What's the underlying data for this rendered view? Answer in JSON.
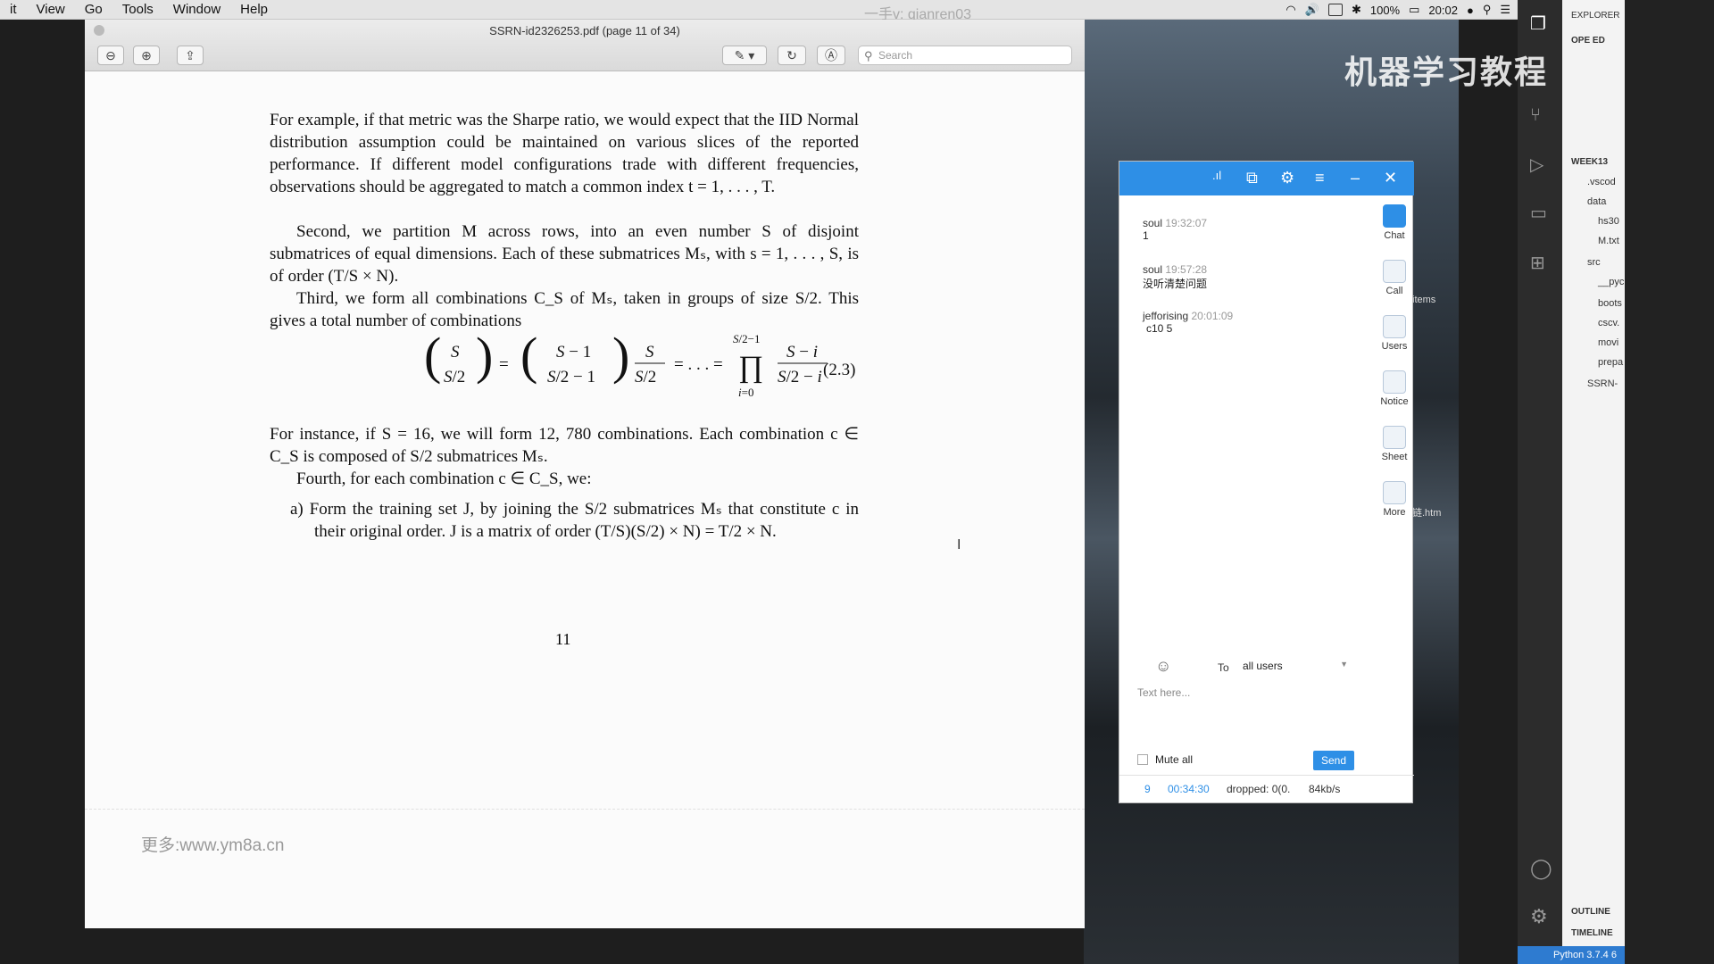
{
  "menubar": {
    "items": [
      "it",
      "View",
      "Go",
      "Tools",
      "Window",
      "Help"
    ],
    "user_watermark": "一手v: qianren03",
    "battery": "100%",
    "time": "20:02"
  },
  "pdf": {
    "title": "SSRN-id2326253.pdf (page 11 of 34)",
    "search_placeholder": "Search",
    "paragraphs": [
      "For example, if that metric was the Sharpe ratio, we would expect that the IID Normal distribution assumption could be maintained on various slices of the reported performance. If different model configurations trade with different frequencies, observations should be aggregated to match a common index t = 1, . . . , T.",
      "Second, we partition M across rows, into an even number S of disjoint submatrices of equal dimensions. Each of these submatrices Mₛ, with s = 1, . . . , S, is of order (T/S × N).",
      "Third, we form all combinations C_S of Mₛ, taken in groups of size S/2. This gives a total number of combinations",
      "For instance, if S = 16, we will form 12, 780 combinations. Each combination c ∈ C_S is composed of S/2 submatrices Mₛ.",
      "Fourth, for each combination c ∈ C_S, we:",
      "a) Form the training set J, by joining the S/2 submatrices Mₛ that constitute c in their original order. J is a matrix of order (T/S)(S/2) × N) = T/2 × N."
    ],
    "equation_number": "(2.3)",
    "page_number": "11",
    "footer_watermark": "更多:www.ym8a.cn"
  },
  "chat": {
    "messages": [
      {
        "who": "soul",
        "time": "19:32:07",
        "text": "1"
      },
      {
        "who": "soul",
        "time": "19:57:28",
        "text": "没听清楚问题"
      },
      {
        "who": "jefforising",
        "time": "20:01:09",
        "text": "c10 5"
      }
    ],
    "side": [
      "Chat",
      "Call",
      "Users",
      "Notice",
      "Sheet",
      "More"
    ],
    "to_label": "To",
    "to_value": "all users",
    "input_placeholder": "Text here...",
    "mute_label": "Mute all",
    "send_label": "Send",
    "status": {
      "count": "9",
      "elapsed": "00:34:30",
      "dropped": "dropped: 0(0.",
      "rate": "84kb/s"
    }
  },
  "vscode": {
    "explorer": "EXPLORER",
    "open_editors": "OPE  ED",
    "workspace": "WEEK13",
    "items": [
      ".vscod",
      "data",
      "hs30",
      "M.txt",
      "src",
      "__pyc",
      "boots",
      "cscv.",
      "movi",
      "prepa",
      "SSRN-"
    ],
    "outline": "OUTLINE",
    "timeline": "TIMELINE",
    "python": "Python 3.7.4 6"
  },
  "overlay": {
    "bili_text": "机器学习教程",
    "items_label": "items",
    "htm_label": "链.htm"
  }
}
